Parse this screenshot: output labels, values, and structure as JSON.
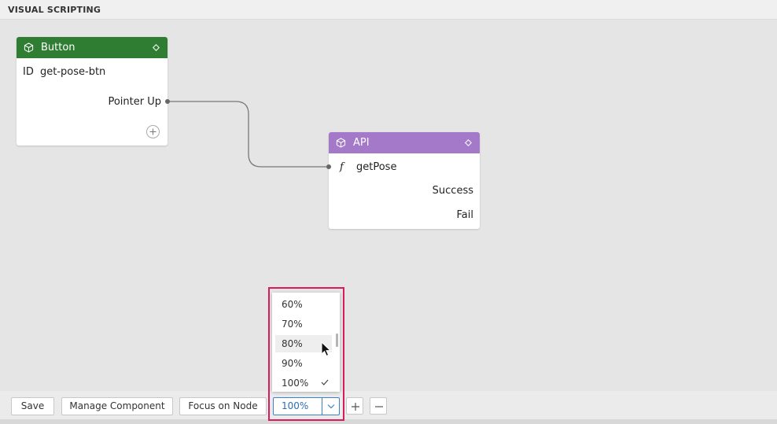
{
  "panel": {
    "title": "VISUAL SCRIPTING"
  },
  "nodes": {
    "button": {
      "title": "Button",
      "header_color": "#2e7d32",
      "id_label": "ID",
      "id_value": "get-pose-btn",
      "output_port": "Pointer Up"
    },
    "api": {
      "title": "API",
      "header_color": "#a479c9",
      "func_icon": "f",
      "function_name": "getPose",
      "output_success": "Success",
      "output_fail": "Fail"
    }
  },
  "toolbar": {
    "save_label": "Save",
    "manage_label": "Manage Component",
    "focus_label": "Focus on Node",
    "zoom_value": "100%",
    "zoom_in_icon": "plus-icon",
    "zoom_out_icon": "minus-icon"
  },
  "zoom_dropdown": {
    "options": [
      "60%",
      "70%",
      "80%",
      "90%",
      "100%"
    ],
    "hovered": "80%",
    "selected": "100%"
  },
  "colors": {
    "button_header": "#2e7d32",
    "api_header": "#a479c9",
    "highlight": "#d91a5b",
    "select_accent": "#3d82c8"
  }
}
